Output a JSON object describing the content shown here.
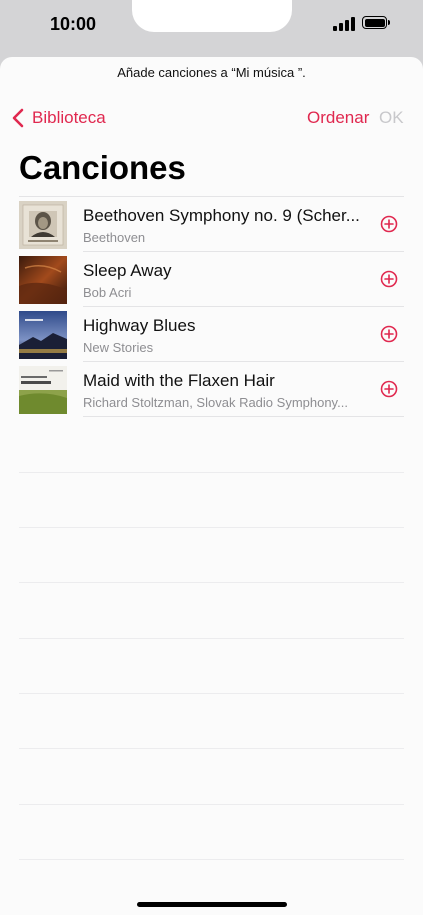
{
  "status_bar": {
    "time": "10:00"
  },
  "prompt": "Añade canciones a “Mi música ”.",
  "nav": {
    "back_label": "Biblioteca",
    "sort_label": "Ordenar",
    "ok_label": "OK"
  },
  "title": "Canciones",
  "songs": [
    {
      "title": "Beethoven Symphony no. 9 (Scher...",
      "artist": "Beethoven",
      "art": "beethoven-album-art"
    },
    {
      "title": "Sleep Away",
      "artist": "Bob Acri",
      "art": "sleep-away-album-art"
    },
    {
      "title": "Highway Blues",
      "artist": "New Stories",
      "art": "highway-blues-album-art"
    },
    {
      "title": "Maid with the Flaxen Hair",
      "artist": "Richard Stoltzman, Slovak Radio Symphony...",
      "art": "stoltzman-album-art"
    }
  ],
  "colors": {
    "accent": "#e0284f",
    "disabled": "#c8c8cb",
    "secondary_text": "#8e8e92"
  },
  "icons": {
    "back": "chevron-left-icon",
    "add": "plus-circle-icon"
  }
}
